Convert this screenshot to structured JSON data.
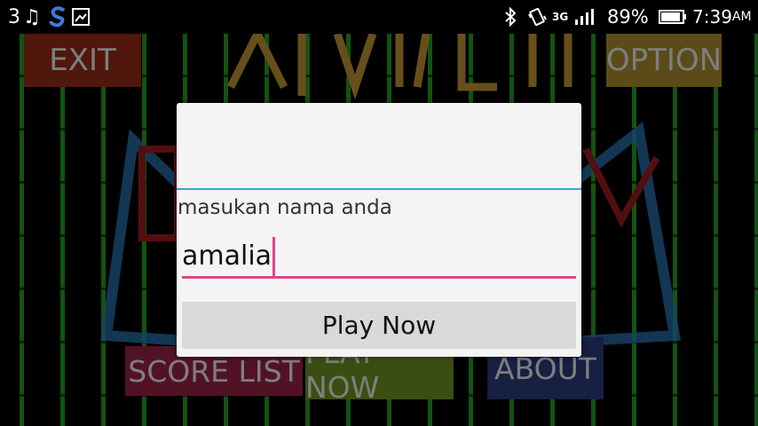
{
  "status_bar": {
    "notification_count": "3",
    "icons": [
      "music-icon",
      "s-app-icon",
      "image-icon",
      "bluetooth-icon",
      "vibrate-icon",
      "network-3g-icon",
      "signal-icon",
      "battery-icon"
    ],
    "network_type": "3G",
    "battery_percent": "89%",
    "time": "7:39",
    "time_suffix": "AM"
  },
  "game_menu": {
    "exit_label": "EXIT",
    "option_label": "OPTION",
    "score_list_label": "SCORE LIST",
    "play_now_label": "PLAY NOW",
    "about_label": "ABOUT"
  },
  "dialog": {
    "title": "",
    "message": "masukan nama anda",
    "name_input_value": "amalia",
    "play_button_label": "Play Now"
  },
  "colors": {
    "dialog_divider": "#33a9d6",
    "input_underline": "#e2458b",
    "bamboo": "#1b6e19"
  }
}
